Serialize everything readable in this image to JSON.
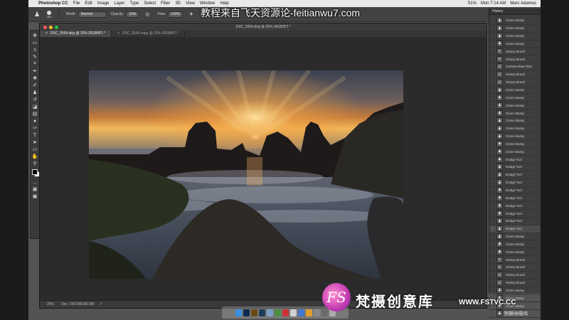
{
  "menubar": {
    "app": "Photoshop CC",
    "items": [
      "File",
      "Edit",
      "Image",
      "Layer",
      "Type",
      "Select",
      "Filter",
      "3D",
      "View",
      "Window",
      "Help"
    ],
    "battery": "51%",
    "clock": "Mon 7:14 AM",
    "user": "Marc Adamus"
  },
  "options": {
    "brush_size": "350",
    "mode_label": "Mode:",
    "mode_value": "Normal",
    "opacity_label": "Opacity:",
    "opacity_value": "10%",
    "flow_label": "Flow:",
    "flow_value": "100%"
  },
  "document": {
    "window_title": "DSC_5554.dng @ 25% (RGB/8*) *",
    "tabs": [
      {
        "label": "DSC_5554.dng @ 25% (RGB/8*) *",
        "close": "×",
        "active": true
      },
      {
        "label": "DSC_5554 copy @ 25% (RGB/8*) *",
        "close": "×",
        "active": false
      }
    ],
    "zoom": "25%",
    "doc_info": "Doc: 150.0M/150.0M",
    "status_arrow": ">"
  },
  "history": {
    "title": "History",
    "items": [
      {
        "label": "Clone Stamp",
        "icon": "stamp-icon",
        "glyph": "♟",
        "current": false
      },
      {
        "label": "Clone Stamp",
        "icon": "stamp-icon",
        "glyph": "♟",
        "current": false
      },
      {
        "label": "Clone Stamp",
        "icon": "stamp-icon",
        "glyph": "♟",
        "current": false
      },
      {
        "label": "Clone Stamp",
        "icon": "stamp-icon",
        "glyph": "♟",
        "current": false
      },
      {
        "label": "History Brush",
        "icon": "history-brush-icon",
        "glyph": "≡",
        "current": false
      },
      {
        "label": "History Brush",
        "icon": "history-brush-icon",
        "glyph": "≡",
        "current": false
      },
      {
        "label": "Camera Raw Filter",
        "icon": "filter-icon",
        "glyph": "≡",
        "current": false
      },
      {
        "label": "History Brush",
        "icon": "history-brush-icon",
        "glyph": "≡",
        "current": false
      },
      {
        "label": "History Brush",
        "icon": "history-brush-icon",
        "glyph": "≡",
        "current": false
      },
      {
        "label": "Clone Stamp",
        "icon": "stamp-icon",
        "glyph": "♟",
        "current": false
      },
      {
        "label": "Clone Stamp",
        "icon": "stamp-icon",
        "glyph": "♟",
        "current": false
      },
      {
        "label": "Clone Stamp",
        "icon": "stamp-icon",
        "glyph": "♟",
        "current": false
      },
      {
        "label": "Clone Stamp",
        "icon": "stamp-icon",
        "glyph": "♟",
        "current": false
      },
      {
        "label": "Clone Stamp",
        "icon": "stamp-icon",
        "glyph": "♟",
        "current": false
      },
      {
        "label": "Clone Stamp",
        "icon": "stamp-icon",
        "glyph": "♟",
        "current": false
      },
      {
        "label": "Clone Stamp",
        "icon": "stamp-icon",
        "glyph": "♟",
        "current": false
      },
      {
        "label": "Clone Stamp",
        "icon": "stamp-icon",
        "glyph": "♟",
        "current": false
      },
      {
        "label": "Clone Stamp",
        "icon": "stamp-icon",
        "glyph": "♟",
        "current": false
      },
      {
        "label": "Dodge Tool",
        "icon": "dodge-icon",
        "glyph": "♟",
        "current": false
      },
      {
        "label": "Dodge Tool",
        "icon": "dodge-icon",
        "glyph": "♟",
        "current": false
      },
      {
        "label": "Dodge Tool",
        "icon": "dodge-icon",
        "glyph": "♟",
        "current": false
      },
      {
        "label": "Dodge Tool",
        "icon": "dodge-icon",
        "glyph": "♟",
        "current": false
      },
      {
        "label": "Dodge Tool",
        "icon": "dodge-icon",
        "glyph": "♟",
        "current": false
      },
      {
        "label": "Dodge Tool",
        "icon": "dodge-icon",
        "glyph": "♟",
        "current": false
      },
      {
        "label": "Dodge Tool",
        "icon": "dodge-icon",
        "glyph": "♟",
        "current": false
      },
      {
        "label": "Dodge Tool",
        "icon": "dodge-icon",
        "glyph": "♟",
        "current": false
      },
      {
        "label": "Dodge Tool",
        "icon": "dodge-icon",
        "glyph": "♟",
        "current": false
      },
      {
        "label": "Dodge Tool",
        "icon": "dodge-icon",
        "glyph": "♟",
        "current": true
      },
      {
        "label": "Clone Stamp",
        "icon": "stamp-icon",
        "glyph": "♟",
        "current": false
      },
      {
        "label": "Clone Stamp",
        "icon": "stamp-icon",
        "glyph": "♟",
        "current": false
      },
      {
        "label": "Clone Stamp",
        "icon": "stamp-icon",
        "glyph": "♟",
        "current": false
      },
      {
        "label": "History Brush",
        "icon": "history-brush-icon",
        "glyph": "≡",
        "current": false
      },
      {
        "label": "History Brush",
        "icon": "history-brush-icon",
        "glyph": "≡",
        "current": false
      },
      {
        "label": "History Brush",
        "icon": "history-brush-icon",
        "glyph": "≡",
        "current": false
      },
      {
        "label": "History Brush",
        "icon": "history-brush-icon",
        "glyph": "≡",
        "current": false
      },
      {
        "label": "Clone Stamp",
        "icon": "stamp-icon",
        "glyph": "♟",
        "current": false
      },
      {
        "label": "Clone Stamp",
        "icon": "stamp-icon",
        "glyph": "♟",
        "current": false
      },
      {
        "label": "Clone Stamp",
        "icon": "stamp-icon",
        "glyph": "♟",
        "current": false
      },
      {
        "label": "Clone Stamp",
        "icon": "stamp-icon",
        "glyph": "♟",
        "current": false
      }
    ]
  },
  "tools": [
    {
      "name": "move-tool-icon",
      "glyph": "✥"
    },
    {
      "name": "marquee-tool-icon",
      "glyph": "▭"
    },
    {
      "name": "lasso-tool-icon",
      "glyph": "ↄ"
    },
    {
      "name": "quick-select-tool-icon",
      "glyph": "✎"
    },
    {
      "name": "crop-tool-icon",
      "glyph": "⌗"
    },
    {
      "name": "eyedropper-tool-icon",
      "glyph": "✒"
    },
    {
      "name": "healing-tool-icon",
      "glyph": "✚"
    },
    {
      "name": "brush-tool-icon",
      "glyph": "✐"
    },
    {
      "name": "clone-stamp-tool-icon",
      "glyph": "♟"
    },
    {
      "name": "history-brush-tool-icon",
      "glyph": "↺"
    },
    {
      "name": "eraser-tool-icon",
      "glyph": "◪"
    },
    {
      "name": "gradient-tool-icon",
      "glyph": "▤"
    },
    {
      "name": "dodge-tool-icon",
      "glyph": "●"
    },
    {
      "name": "pen-tool-icon",
      "glyph": "✑"
    },
    {
      "name": "type-tool-icon",
      "glyph": "T"
    },
    {
      "name": "path-select-tool-icon",
      "glyph": "➤"
    },
    {
      "name": "shape-tool-icon",
      "glyph": "▭"
    },
    {
      "name": "hand-tool-icon",
      "glyph": "✋"
    },
    {
      "name": "zoom-tool-icon",
      "glyph": "⚲"
    },
    {
      "name": "more-tools-icon",
      "glyph": "…"
    }
  ],
  "overlays": {
    "watermark_top": "教程来自飞天资源论-feitianwu7.com",
    "logo_letters": "FS",
    "brand": "梵摄创意库",
    "url": "WWW.FSTVC.CC",
    "small": "梵摄创意库"
  },
  "colors": {
    "accent_close": "#fc5f57",
    "accent_min": "#fdbc2e",
    "accent_max": "#28c840"
  }
}
